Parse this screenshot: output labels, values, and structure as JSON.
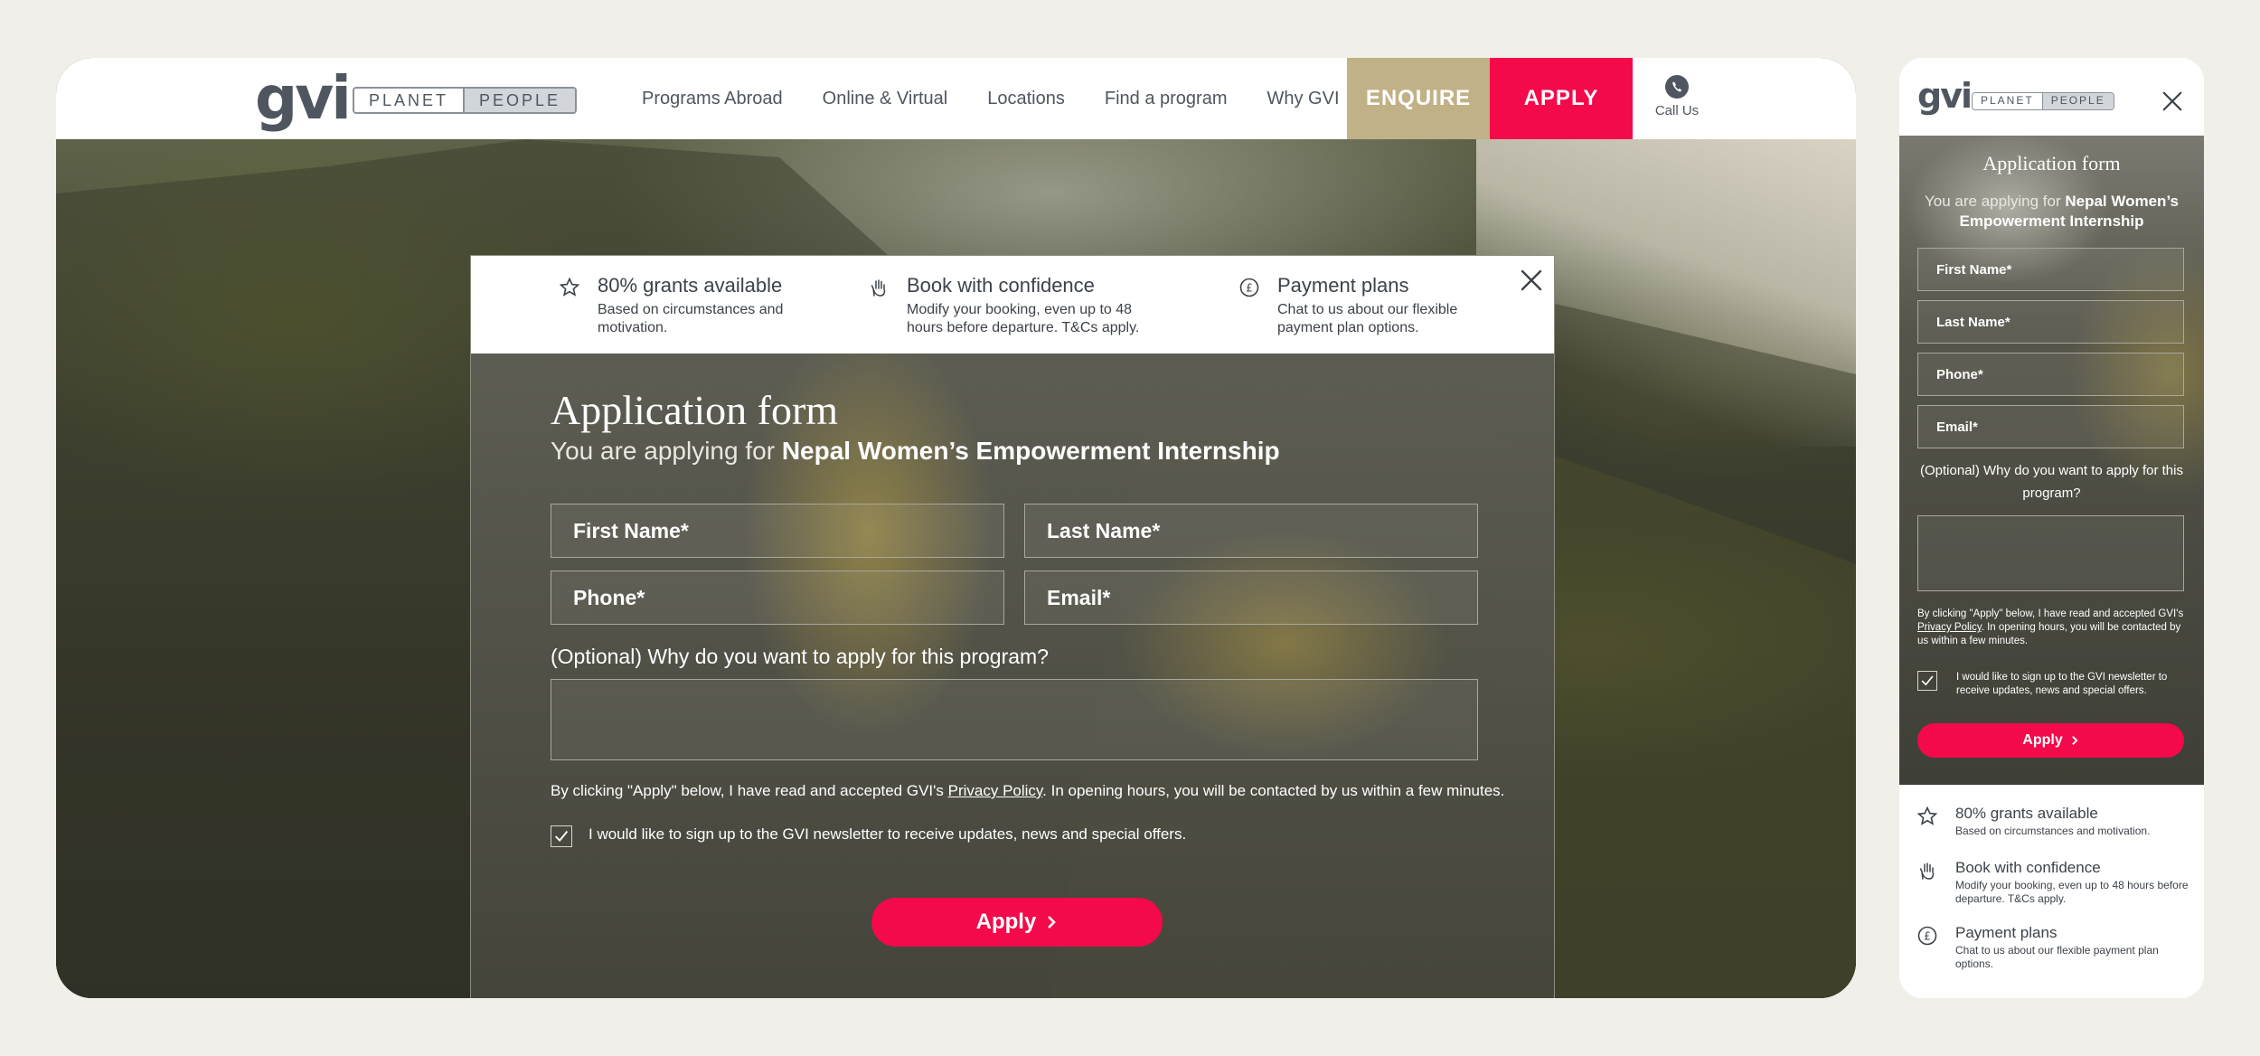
{
  "brand": {
    "logo": "gvi",
    "toggle_left": "PLANET",
    "toggle_right": "PEOPLE"
  },
  "nav": {
    "items": [
      "Programs Abroad",
      "Online & Virtual",
      "Locations",
      "Find a program",
      "Why GVI"
    ],
    "enquire": "ENQUIRE",
    "apply": "APPLY",
    "call": "Call Us"
  },
  "benefits": [
    {
      "icon": "star-icon",
      "title": "80% grants available",
      "text": "Based on circumstances and motivation."
    },
    {
      "icon": "hand-icon",
      "title": "Book with confidence",
      "text": "Modify your booking, even up to 48 hours before departure. T&Cs apply."
    },
    {
      "icon": "pound-icon",
      "title": "Payment plans",
      "text": "Chat to us about our flexible payment plan options."
    }
  ],
  "form": {
    "title": "Application form",
    "sub_prefix": "You are applying for ",
    "program": "Nepal Women’s Empowerment Internship",
    "first_name": "First Name*",
    "last_name": "Last Name*",
    "phone": "Phone*",
    "email": "Email*",
    "question": "(Optional) Why do you want to apply for this program?",
    "consent_prefix": "By clicking \"Apply\" below, I have read and accepted GVI's ",
    "privacy_link": "Privacy Policy",
    "consent_suffix": ". In opening hours, you will be contacted by us within a few minutes.",
    "newsletter": "I would like to sign up to the GVI newsletter to receive updates, news and special offers.",
    "newsletter_checked": true,
    "apply_label": "Apply"
  },
  "colors": {
    "apply": "#f4094a",
    "enquire": "#c1b186",
    "text_dark": "#4f5660"
  }
}
